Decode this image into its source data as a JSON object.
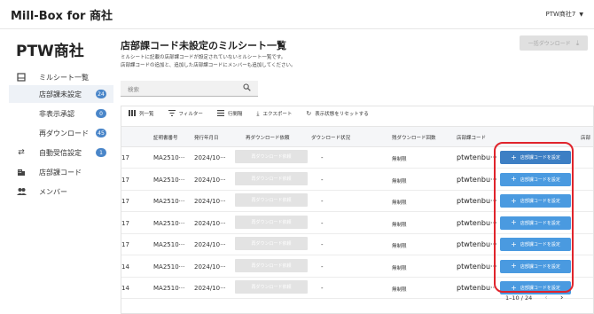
{
  "app": {
    "brand": "Mill-Box for 商社",
    "account": "PTW商社7",
    "account_caret": "▼"
  },
  "sidebar": {
    "title": "PTW商社",
    "items": [
      {
        "label": "ミルシート一覧",
        "icon": "sheet-icon"
      },
      {
        "label": "店部課未設定",
        "badge": "24",
        "sub": true,
        "active": true
      },
      {
        "label": "非表示承認",
        "badge": "0",
        "sub": true
      },
      {
        "label": "再ダウンロード",
        "badge": "45",
        "sub": true
      },
      {
        "label": "自動受信設定",
        "badge": "1",
        "icon": "swap-icon"
      },
      {
        "label": "店部課コード",
        "icon": "building-icon"
      },
      {
        "label": "メンバー",
        "icon": "people-icon"
      }
    ]
  },
  "main": {
    "title": "店部課コード未設定のミルシート一覧",
    "desc_line1": "ミルシートに記載の店部課コードが設定されていないミルシート一覧です。",
    "desc_line2": "店部課コードの追加と、追加した店部課コードにメンバーも追加してください。",
    "bulk_download": "一括ダウンロード",
    "search_placeholder": "検索"
  },
  "toolbar": {
    "columns": "列一覧",
    "filter": "フィルター",
    "row_height": "行間隔",
    "export": "エクスポート",
    "reset": "表示状態をリセットする"
  },
  "table": {
    "headers": [
      "証明書番号",
      "発行年月日",
      "再ダウンロード依頼",
      "ダウンロード状況",
      "残ダウンロード回数",
      "店部課コード",
      "店部"
    ],
    "redownload_label": "再ダウンロード依頼",
    "assign_label": "店部課コードを設定",
    "rows": [
      {
        "lead": "17",
        "cert": "MA2510···",
        "date": "2024/10···",
        "status": "-",
        "remain": "無制限",
        "code": "ptwtenbu···"
      },
      {
        "lead": "17",
        "cert": "MA2510···",
        "date": "2024/10···",
        "status": "-",
        "remain": "無制限",
        "code": "ptwtenbu···"
      },
      {
        "lead": "17",
        "cert": "MA2510···",
        "date": "2024/10···",
        "status": "-",
        "remain": "無制限",
        "code": "ptwtenbu···"
      },
      {
        "lead": "17",
        "cert": "MA2510···",
        "date": "2024/10···",
        "status": "-",
        "remain": "無制限",
        "code": "ptwtenbu···"
      },
      {
        "lead": "17",
        "cert": "MA2510···",
        "date": "2024/10···",
        "status": "-",
        "remain": "無制限",
        "code": "ptwtenbu···"
      },
      {
        "lead": "14",
        "cert": "MA2510···",
        "date": "2024/10···",
        "status": "-",
        "remain": "無制限",
        "code": "ptwtenbu···"
      },
      {
        "lead": "14",
        "cert": "MA2510···",
        "date": "2024/10···",
        "status": "-",
        "remain": "無制限",
        "code": "ptwtenbu···"
      }
    ]
  },
  "pagination": {
    "range": "1–10 / 24",
    "prev": "‹",
    "next": "›"
  },
  "colors": {
    "accent": "#4a9ae0",
    "badge": "#4a86c9",
    "highlight": "#e0242c"
  }
}
